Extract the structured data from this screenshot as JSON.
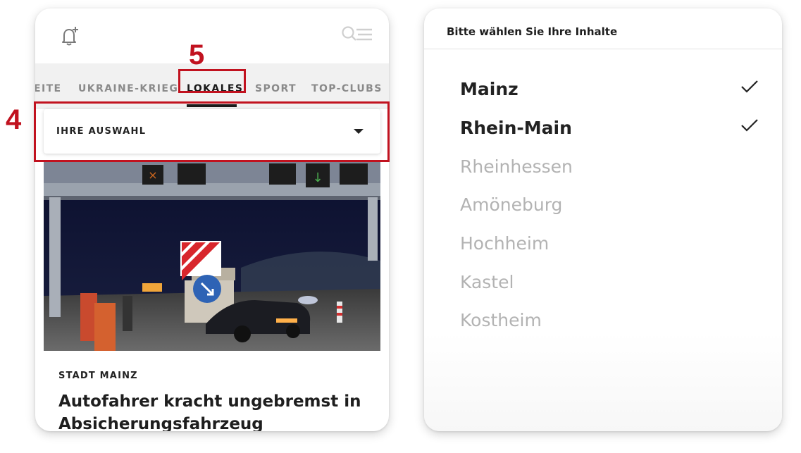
{
  "left_phone": {
    "top_bar": {
      "bell_icon": "bell-plus-icon",
      "search_menu_icon": "search-menu-icon"
    },
    "nav_tabs": [
      {
        "label": "EITE",
        "active": false
      },
      {
        "label": "UKRAINE-KRIEG",
        "active": false
      },
      {
        "label": "LOKALES",
        "active": true
      },
      {
        "label": "SPORT",
        "active": false
      },
      {
        "label": "TOP-CLUBS",
        "active": false
      }
    ],
    "dropdown": {
      "label": "IHRE AUSWAHL"
    },
    "article": {
      "section": "STADT MAINZ",
      "title": "Autofahrer kracht ungebremst in Absicherungsfahrzeug"
    }
  },
  "annotations": {
    "tabs_marker": "5",
    "dropdown_marker": "4",
    "color": "#c1121f"
  },
  "right_panel": {
    "title": "Bitte wählen Sie Ihre Inhalte",
    "options": [
      {
        "label": "Mainz",
        "selected": true
      },
      {
        "label": "Rhein-Main",
        "selected": true
      },
      {
        "label": "Rheinhessen",
        "selected": false
      },
      {
        "label": "Amöneburg",
        "selected": false
      },
      {
        "label": "Hochheim",
        "selected": false
      },
      {
        "label": "Kastel",
        "selected": false
      },
      {
        "label": "Kostheim",
        "selected": false
      }
    ]
  }
}
